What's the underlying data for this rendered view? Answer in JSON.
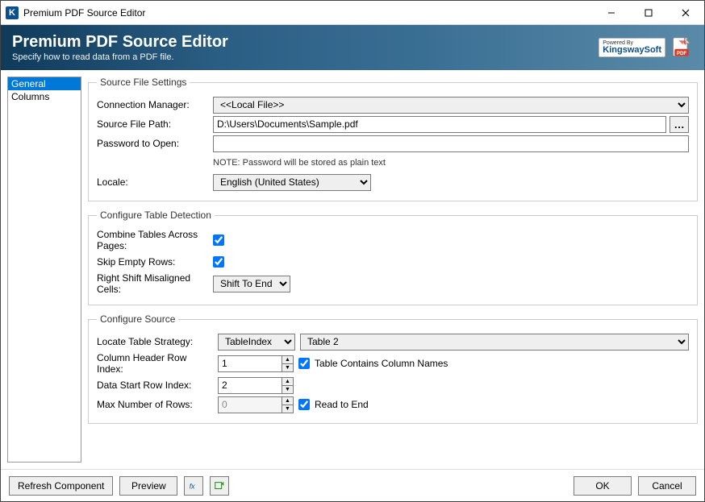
{
  "window": {
    "title": "Premium PDF Source Editor"
  },
  "banner": {
    "title": "Premium PDF Source Editor",
    "subtitle": "Specify how to read data from a PDF file.",
    "powered_by": "Powered By",
    "brand": "KingswaySoft"
  },
  "sidebar": {
    "items": [
      "General",
      "Columns"
    ],
    "selected": "General"
  },
  "sourceFile": {
    "legend": "Source File Settings",
    "connection_label": "Connection Manager:",
    "connection_value": "<<Local File>>",
    "path_label": "Source File Path:",
    "path_value": "D:\\Users\\Documents\\Sample.pdf",
    "password_label": "Password to Open:",
    "password_value": "",
    "password_note": "NOTE: Password will be stored as plain text",
    "locale_label": "Locale:",
    "locale_value": "English (United States)"
  },
  "tableDetection": {
    "legend": "Configure Table Detection",
    "combine_label": "Combine Tables Across Pages:",
    "combine_checked": true,
    "skip_label": "Skip Empty Rows:",
    "skip_checked": true,
    "shift_label": "Right Shift Misaligned Cells:",
    "shift_value": "Shift To End"
  },
  "configureSource": {
    "legend": "Configure Source",
    "strategy_label": "Locate Table Strategy:",
    "strategy_value": "TableIndex",
    "table_value": "Table 2",
    "header_idx_label": "Column Header Row Index:",
    "header_idx_value": "1",
    "contains_names_label": "Table Contains Column Names",
    "contains_names_checked": true,
    "data_start_label": "Data Start Row Index:",
    "data_start_value": "2",
    "max_rows_label": "Max Number of Rows:",
    "max_rows_value": "0",
    "read_to_end_label": "Read to End",
    "read_to_end_checked": true
  },
  "footer": {
    "refresh": "Refresh Component",
    "preview": "Preview",
    "ok": "OK",
    "cancel": "Cancel"
  }
}
